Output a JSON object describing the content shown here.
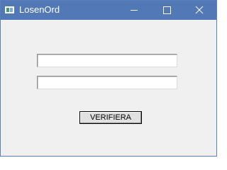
{
  "window": {
    "title": "LosenOrd",
    "icon": "app-window-icon",
    "title_bar_color": "#5278b5",
    "controls": {
      "minimize_icon": "minimize-icon",
      "maximize_icon": "maximize-icon",
      "close_icon": "close-icon"
    }
  },
  "form": {
    "field1": {
      "value": "",
      "placeholder": ""
    },
    "field2": {
      "value": "",
      "placeholder": ""
    },
    "verify_label": "VERIFIERA"
  }
}
